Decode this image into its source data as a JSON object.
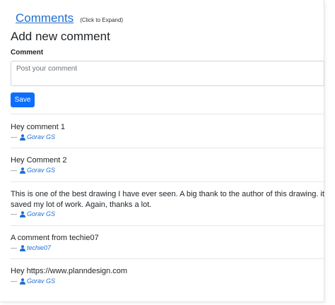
{
  "header": {
    "comments_link": "Comments",
    "expand_hint": "(Click to Expand)"
  },
  "form": {
    "title": "Add new comment",
    "label": "Comment",
    "placeholder": "Post your comment",
    "value": "",
    "save_label": "Save"
  },
  "comments": [
    {
      "text": "Hey comment 1",
      "dash": "—",
      "author": "Gorav GS"
    },
    {
      "text": "Hey Comment 2",
      "dash": "—",
      "author": "Gorav GS"
    },
    {
      "text": "This is one of the best drawing I have ever seen. A big thank to the author of this drawing. it saved my lot of work. Again, thanks a lot.",
      "dash": "—",
      "author": "Gorav GS"
    },
    {
      "text": "A comment from techie07",
      "dash": "—",
      "author": "techie07"
    },
    {
      "text": "Hey https://www.planndesign.com",
      "dash": "—",
      "author": "Gorav GS"
    }
  ],
  "colors": {
    "link": "#1f6fd1",
    "primary_button": "#0d6efd",
    "divider": "#e6e6e6"
  },
  "icons": {
    "author": "user-icon"
  }
}
